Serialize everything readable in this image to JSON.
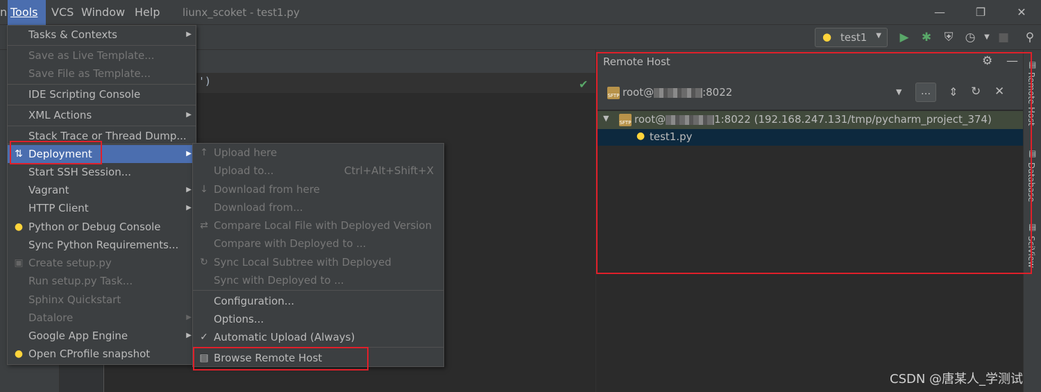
{
  "menubar": {
    "items": [
      {
        "label": "Tools",
        "active": true
      },
      {
        "label": "VCS"
      },
      {
        "label": "Window"
      },
      {
        "label": "Help"
      }
    ],
    "title": "liunx_scoket - test1.py",
    "window_buttons": [
      "minimize-icon",
      "restore-icon",
      "close-icon"
    ]
  },
  "toolbar": {
    "run_config": "test1"
  },
  "editor": {
    "code_line": "')"
  },
  "tools_menu": [
    {
      "label": "Tasks & Contexts",
      "submenu": true
    },
    {
      "label": "Save as Live Template...",
      "disabled": true
    },
    {
      "label": "Save File as Template...",
      "disabled": true
    },
    {
      "label": "IDE Scripting Console"
    },
    {
      "label": "XML Actions",
      "submenu": true
    },
    {
      "label": "Stack Trace or Thread Dump..."
    },
    {
      "label": "Deployment",
      "submenu": true,
      "selected": true
    },
    {
      "label": "Start SSH Session..."
    },
    {
      "label": "Vagrant",
      "submenu": true
    },
    {
      "label": "HTTP Client",
      "submenu": true
    },
    {
      "label": "Python or Debug Console"
    },
    {
      "label": "Sync Python Requirements..."
    },
    {
      "label": "Create setup.py",
      "disabled": true
    },
    {
      "label": "Run setup.py Task...",
      "disabled": true
    },
    {
      "label": "Sphinx Quickstart",
      "disabled": true
    },
    {
      "label": "Datalore",
      "disabled": true,
      "submenu": true
    },
    {
      "label": "Google App Engine",
      "submenu": true
    },
    {
      "label": "Open CProfile snapshot"
    }
  ],
  "deployment_menu": [
    {
      "label": "Upload here",
      "disabled": true
    },
    {
      "label": "Upload to...",
      "disabled": true,
      "shortcut": "Ctrl+Alt+Shift+X"
    },
    {
      "label": "Download from here",
      "disabled": true
    },
    {
      "label": "Download from...",
      "disabled": true
    },
    {
      "label": "Compare Local File with Deployed Version",
      "disabled": true
    },
    {
      "label": "Compare with Deployed to ...",
      "disabled": true
    },
    {
      "label": "Sync Local Subtree with Deployed",
      "disabled": true
    },
    {
      "label": "Sync with Deployed to ...",
      "disabled": true
    },
    {
      "label": "Configuration..."
    },
    {
      "label": "Options..."
    },
    {
      "label": "Automatic Upload (Always)",
      "checked": true
    },
    {
      "label": "Browse Remote Host"
    }
  ],
  "remote_host": {
    "title": "Remote Host",
    "server_prefix": "root@",
    "server_suffix": ":8022",
    "browse_button": "...",
    "tree_root_prefix": "root@",
    "tree_root_suffix": "1:8022 (192.168.247.131/tmp/pycharm_project_374)",
    "tree_child": "test1.py"
  },
  "right_stripe": [
    "Remote Host",
    "Database",
    "SciView"
  ],
  "watermark": "CSDN @唐某人_学测试",
  "colors": {
    "selection": "#4b6eaf",
    "highlight_box": "#e0202a",
    "panel_bg": "#3c3f41",
    "editor_bg": "#2b2b2b"
  }
}
